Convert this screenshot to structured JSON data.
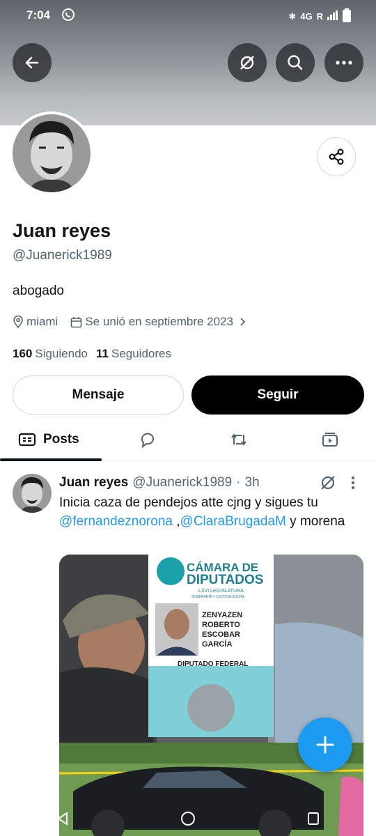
{
  "status": {
    "time": "7:04",
    "network": "4G",
    "roaming": "R"
  },
  "profile": {
    "display_name": "Juan reyes",
    "handle": "@Juanerick1989",
    "bio": "abogado",
    "location": "miami",
    "joined": "Se unió en septiembre 2023",
    "following_count": "160",
    "following_label": "Siguiendo",
    "followers_count": "11",
    "followers_label": "Seguidores"
  },
  "actions": {
    "message_label": "Mensaje",
    "follow_label": "Seguir"
  },
  "tabs": [
    {
      "label": "Posts",
      "icon": "posts-icon",
      "active": true
    },
    {
      "label": "",
      "icon": "replies-icon"
    },
    {
      "label": "",
      "icon": "reposts-icon"
    },
    {
      "label": "",
      "icon": "media-icon"
    }
  ],
  "post": {
    "name": "Juan reyes",
    "handle": "@Juanerick1989",
    "time": "3h",
    "text_before": "Inicia caza de pendejos atte cjng  y sigues tu ",
    "mention1": "@fernandeznorona",
    "sep": " ,",
    "mention2": "@ClaraBrugadaM",
    "text_after": "  y morena"
  },
  "media_card": {
    "line1": "CÁMARA DE",
    "line2": "DIPUTADOS",
    "line3": "LXVI LEGISLATURA",
    "line4": "SOBERANÍA Y JUSTICIA SOCIAL",
    "name1": "ZENYAZEN",
    "name2": "ROBERTO",
    "name3": "ESCOBAR",
    "name4": "GARCÍA",
    "role": "DIPUTADO FEDERAL"
  },
  "colors": {
    "accent": "#1d9bf0",
    "text": "#0f1419",
    "muted": "#536471"
  }
}
